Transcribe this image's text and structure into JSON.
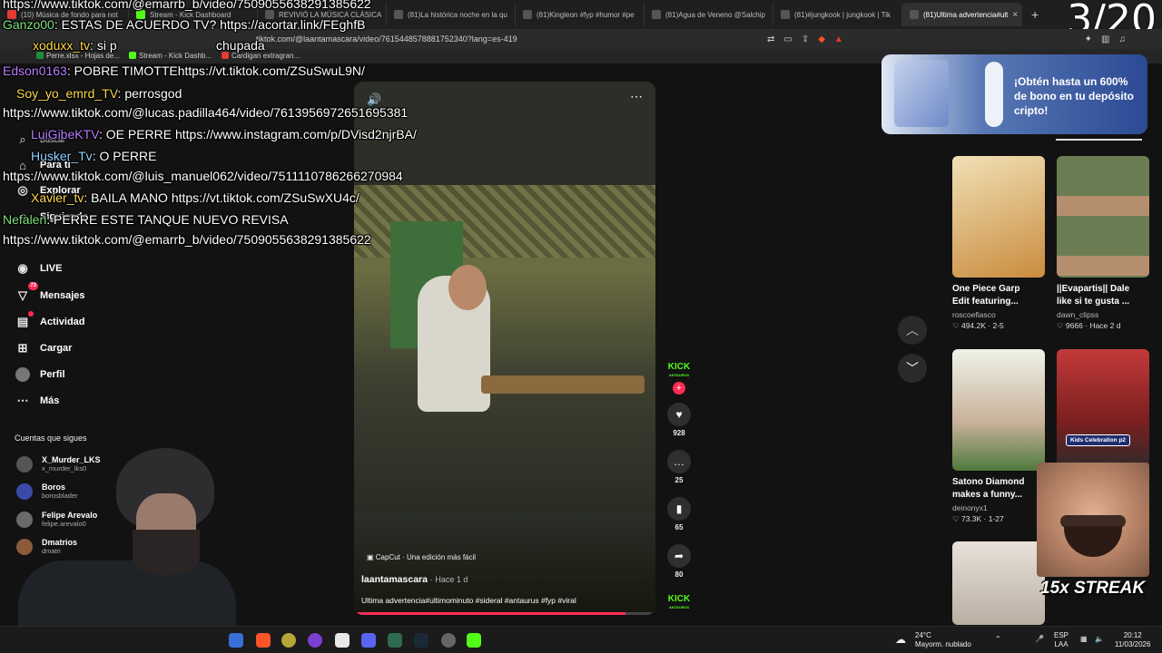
{
  "browser": {
    "tabs": [
      {
        "label": "(10) Música de fondo para not"
      },
      {
        "label": "Stream - Kick Dashboard"
      },
      {
        "label": "REVIVIÓ LA MÚSICA CLÁSICA"
      },
      {
        "label": "(81)La histórica noche en la qu"
      },
      {
        "label": "(81)Kingleon #fyp #humor #pe"
      },
      {
        "label": "(81)Agua de Veneno @Salchip"
      },
      {
        "label": "(81)#jungkook | jungkook | Tik"
      },
      {
        "label": "(81)Ultima advertencia#ult"
      }
    ],
    "counter": "3/20",
    "url": "tiktok.com/@laantamascara/video/7615448578881752340?lang=es-419",
    "bookmarks": [
      "Perre.xlsx - Hojas de...",
      "Stream - Kick Dashb...",
      "Cardigan extragran..."
    ],
    "bookmark_colors": [
      "#1e8e3e",
      "#53fc18",
      "#e53935"
    ]
  },
  "nav": {
    "explore": "Explorar",
    "following": "Siguiendo",
    "search": "Buscar",
    "foryou": "Para ti",
    "live": "LIVE",
    "messages": "Mensajes",
    "messages_badge": "73",
    "activity": "Actividad",
    "upload": "Cargar",
    "profile": "Perfil",
    "more": "Más",
    "following_title": "Cuentas que sigues",
    "following_accounts": [
      {
        "name": "X_Murder_LKS",
        "handle": "x_murder_lks0"
      },
      {
        "name": "Boros",
        "handle": "borosblader"
      },
      {
        "name": "Felipe Arevalo",
        "handle": "felipe.arevalo0"
      },
      {
        "name": "Dmatrios",
        "handle": "dmatri"
      }
    ]
  },
  "chat": [
    {
      "user": "",
      "text": "https://www.tiktok.com/@emarrb_b/video/7509055638291385622",
      "color": "#ffffff"
    },
    {
      "user": "Ganzo00",
      "text": ": ESTAS DE ACUERDO TV? https://acortar.link/FEghfB",
      "color": "#7ee37e"
    },
    {
      "user": "xoduxx_tv",
      "text": ": si p",
      "color": "#ffd84a"
    },
    {
      "user": "",
      "text": "chupada",
      "color": "#ffffff"
    },
    {
      "user": "Edson0163",
      "text": ": POBRE TIMOTTEhttps://vt.tiktok.com/ZSuSwuL9N/",
      "color": "#b97cff"
    },
    {
      "user": "Soy_yo_emrd_TV",
      "text": ": perrosgod",
      "color": "#ffd84a"
    },
    {
      "user": "",
      "text": "https://www.tiktok.com/@lucas.padilla464/video/7613956972651695381",
      "color": "#ffffff"
    },
    {
      "user": "LuiGibeKTV",
      "text": ": OE PERRE https://www.instagram.com/p/DVisd2njrBA/",
      "color": "#b97cff"
    },
    {
      "user": "Husker_Tv",
      "text": ": O PERRE",
      "color": "#8fd0ff"
    },
    {
      "user": "",
      "text": "https://www.tiktok.com/@luis_manuel062/video/7511110786266270984",
      "color": "#ffffff"
    },
    {
      "user": "Xavier_tv",
      "text": ": BAILA MANO https://vt.tiktok.com/ZSuSwXU4c/",
      "color": "#ffd84a"
    },
    {
      "user": "Nefalen",
      "text": ": PERRE ESTE TANQUE NUEVO REVISA",
      "color": "#7ee37e"
    },
    {
      "user": "",
      "text": "https://www.tiktok.com/@emarrb_b/video/7509055638291385622",
      "color": "#ffffff"
    }
  ],
  "video": {
    "capcut": "CapCut · Una edición más fácil",
    "author": "laantamascara",
    "ago": "· Hace 1 d",
    "description": "Ultima advertencia#ultimominuto #sideral #antaurus #fyp #viral",
    "progress": 0.9,
    "likes": "928",
    "comments": "25",
    "saves": "65",
    "shares": "80",
    "kick_label": "KICK",
    "kick_sub": "ANTAURUS"
  },
  "ad": {
    "text": "¡Obtén hasta un 600% de bono en tu depósito cripto!"
  },
  "recommended": [
    {
      "title": "One Piece Garp Edit featuring...",
      "user": "roscoefiasco",
      "meta": "♡ 494.2K · 2-5",
      "color": "#e8c27a"
    },
    {
      "title": "||Evapartis|| Dale like si te gusta ...",
      "user": "dawn_clipss",
      "meta": "♡ 9666 · Hace 2 d",
      "color": "#6b7d52"
    },
    {
      "title": "Satono Diamond makes a funny...",
      "user": "deinonyx1",
      "meta": "♡ 73.3K · 1-27",
      "color": "#dfe8d6"
    },
    {
      "title": "",
      "user": "",
      "meta": "",
      "color": "#c33a3a"
    },
    {
      "title": "",
      "user": "",
      "meta": "",
      "color": "#d9d2ca"
    }
  ],
  "kids_badge": "Kids Celebration p2",
  "streak": "15x STREAK",
  "taskbar": {
    "weather_temp": "24°C",
    "weather_desc": "Mayorm. nublado",
    "lang": "ESP",
    "lang2": "LAA",
    "time": "20:12",
    "date": "11/03/2026"
  }
}
